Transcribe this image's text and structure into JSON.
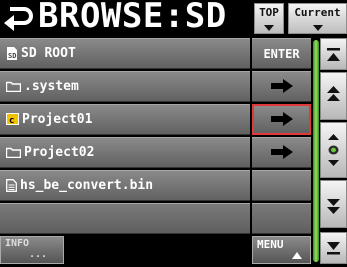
{
  "header": {
    "title": "BROWSE:SD",
    "top_label": "TOP",
    "current_label": "Current"
  },
  "rows": [
    {
      "name": "SD ROOT",
      "icon": "sd-card-icon",
      "action": "ENTER"
    },
    {
      "name": ".system",
      "icon": "folder-icon",
      "action": "arrow"
    },
    {
      "name": "Project01",
      "icon": "project-icon",
      "action": "arrow",
      "highlighted": true
    },
    {
      "name": "Project02",
      "icon": "folder-icon",
      "action": "arrow"
    },
    {
      "name": "hs_be_convert.bin",
      "icon": "file-icon",
      "action": ""
    }
  ],
  "footer": {
    "info_label": "INFO",
    "info_sub": "...",
    "menu_label": "MENU"
  },
  "colors": {
    "background": "#000000",
    "row": "#737373",
    "highlight": "#e23838",
    "scroll_accent": "#6cc83c",
    "project_icon": "#f2c200"
  }
}
